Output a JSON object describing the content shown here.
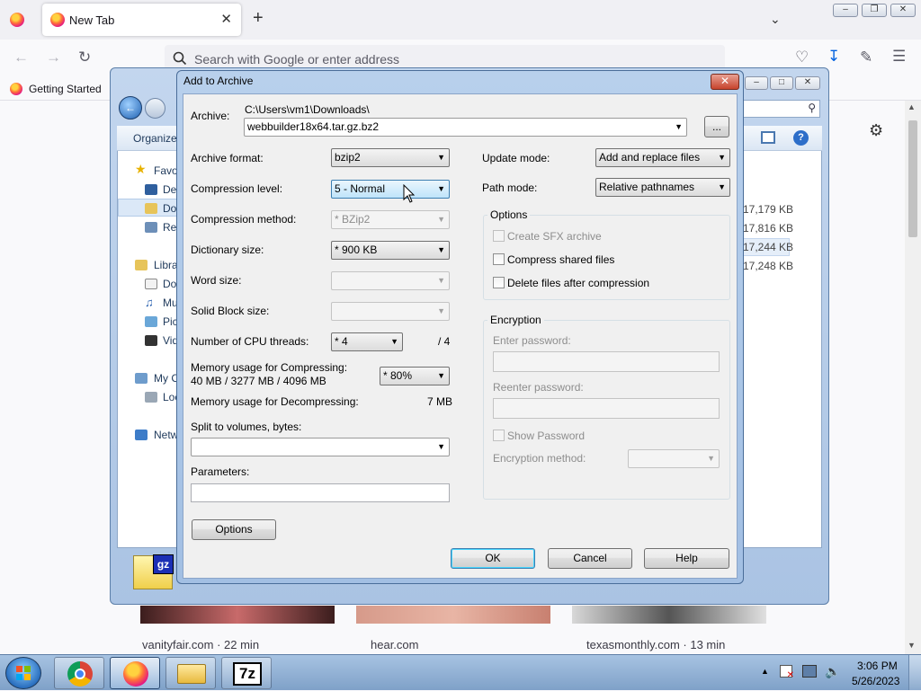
{
  "browser": {
    "tab_title": "New Tab",
    "tab_close": "✕",
    "new_tab": "+",
    "url_placeholder": "Search with Google or enter address",
    "bookmark": "Getting Started",
    "tiles": [
      "vanityfair.com · 22 min",
      "hear.com",
      "texasmonthly.com · 13 min"
    ]
  },
  "explorer": {
    "toolbar_organize": "Organize",
    "nav_items": [
      "Favo",
      "Des",
      "Dov",
      "Rec",
      "Libra",
      "Do",
      "Mu",
      "Pic",
      "Vid",
      "My C",
      "Loc",
      "Netw"
    ],
    "sizes": [
      "17,179 KB",
      "17,816 KB",
      "17,244 KB",
      "17,248 KB"
    ],
    "gz_label": "gz"
  },
  "dialog": {
    "title": "Add to Archive",
    "close": "✕",
    "archive_label": "Archive:",
    "archive_path": "C:\\Users\\vm1\\Downloads\\",
    "archive_name": "webbuilder18x64.tar.gz.bz2",
    "browse": "...",
    "archive_format_label": "Archive format:",
    "archive_format": "bzip2",
    "compression_level_label": "Compression level:",
    "compression_level": "5 - Normal",
    "compression_method_label": "Compression method:",
    "compression_method": "* BZip2",
    "dictionary_size_label": "Dictionary size:",
    "dictionary_size": "* 900 KB",
    "word_size_label": "Word size:",
    "solid_block_label": "Solid Block size:",
    "cpu_threads_label": "Number of CPU threads:",
    "cpu_threads": "* 4",
    "cpu_threads_max": "/ 4",
    "mem_compress_label": "Memory usage for Compressing:",
    "mem_compress_value": "40 MB / 3277 MB / 4096 MB",
    "mem_percent": "* 80%",
    "mem_decompress_label": "Memory usage for Decompressing:",
    "mem_decompress_value": "7 MB",
    "split_label": "Split to volumes, bytes:",
    "params_label": "Parameters:",
    "options_button": "Options",
    "update_mode_label": "Update mode:",
    "update_mode": "Add and replace files",
    "path_mode_label": "Path mode:",
    "path_mode": "Relative pathnames",
    "options_group": "Options",
    "opt_sfx": "Create SFX archive",
    "opt_shared": "Compress shared files",
    "opt_delete": "Delete files after compression",
    "encryption_group": "Encryption",
    "enter_password": "Enter password:",
    "reenter_password": "Reenter password:",
    "show_password": "Show Password",
    "encryption_method": "Encryption method:",
    "ok": "OK",
    "cancel": "Cancel",
    "help": "Help"
  },
  "taskbar": {
    "time": "3:06 PM",
    "date": "5/26/2023",
    "sevenzip_label": "7z"
  }
}
